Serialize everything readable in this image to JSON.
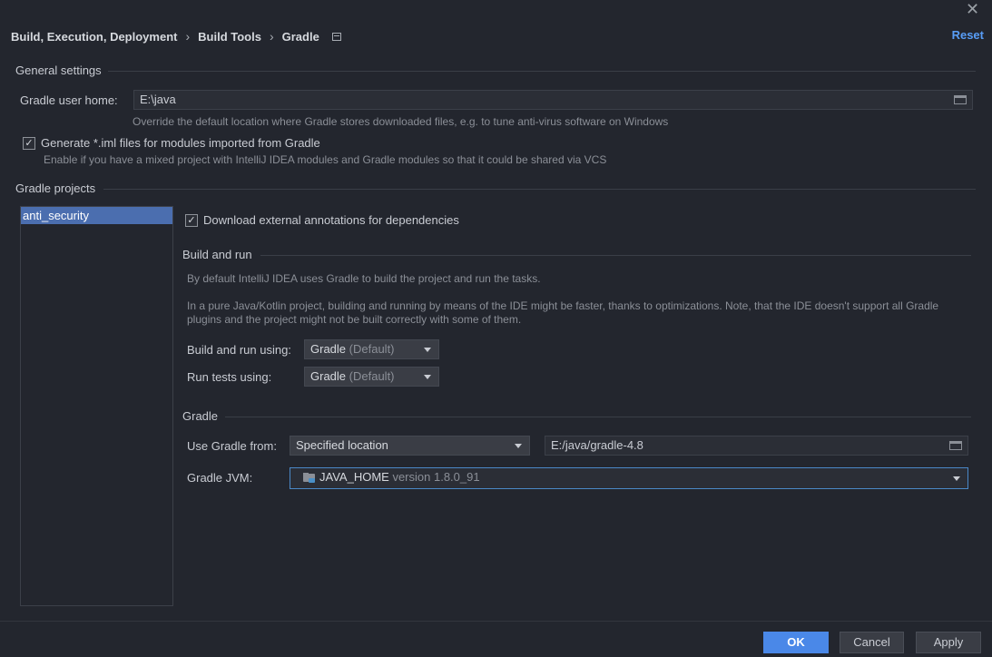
{
  "window": {
    "close_glyph": "✕"
  },
  "breadcrumb": {
    "items": [
      "Build, Execution, Deployment",
      "Build Tools",
      "Gradle"
    ],
    "separator": "›"
  },
  "reset_label": "Reset",
  "general": {
    "title": "General settings",
    "user_home_label": "Gradle user home:",
    "user_home_value": "E:\\java",
    "user_home_hint": "Override the default location where Gradle stores downloaded files, e.g. to tune anti-virus software on Windows",
    "generate_iml_label": "Generate *.iml files for modules imported from Gradle",
    "generate_iml_checked": true,
    "generate_iml_hint": "Enable if you have a mixed project with IntelliJ IDEA modules and Gradle modules so that it could be shared via VCS"
  },
  "projects": {
    "title": "Gradle projects",
    "items": [
      "anti_security"
    ],
    "selected_index": 0
  },
  "project_settings": {
    "download_annotations_label": "Download external annotations for dependencies",
    "download_annotations_checked": true,
    "build_run": {
      "title": "Build and run",
      "desc1": "By default IntelliJ IDEA uses Gradle to build the project and run the tasks.",
      "desc2_line1": "In a pure Java/Kotlin project, building and running by means of the IDE might be faster, thanks to optimizations. Note, that the IDE doesn't support all Gradle",
      "desc2_line2": "plugins and the project might not be built correctly with some of them.",
      "build_using_label": "Build and run using:",
      "build_using_value": "Gradle",
      "build_using_suffix": "(Default)",
      "tests_using_label": "Run tests using:",
      "tests_using_value": "Gradle",
      "tests_using_suffix": "(Default)"
    },
    "gradle": {
      "title": "Gradle",
      "use_from_label": "Use Gradle from:",
      "use_from_value": "Specified location",
      "location_value": "E:/java/gradle-4.8",
      "jvm_label": "Gradle JVM:",
      "jvm_name": "JAVA_HOME",
      "jvm_version": "version 1.8.0_91"
    }
  },
  "footer": {
    "ok_label": "OK",
    "cancel_label": "Cancel",
    "apply_label": "Apply"
  },
  "colors": {
    "background": "#23262e",
    "accent": "#4a88e8",
    "link": "#589df6",
    "selection": "#4b6eaf"
  }
}
